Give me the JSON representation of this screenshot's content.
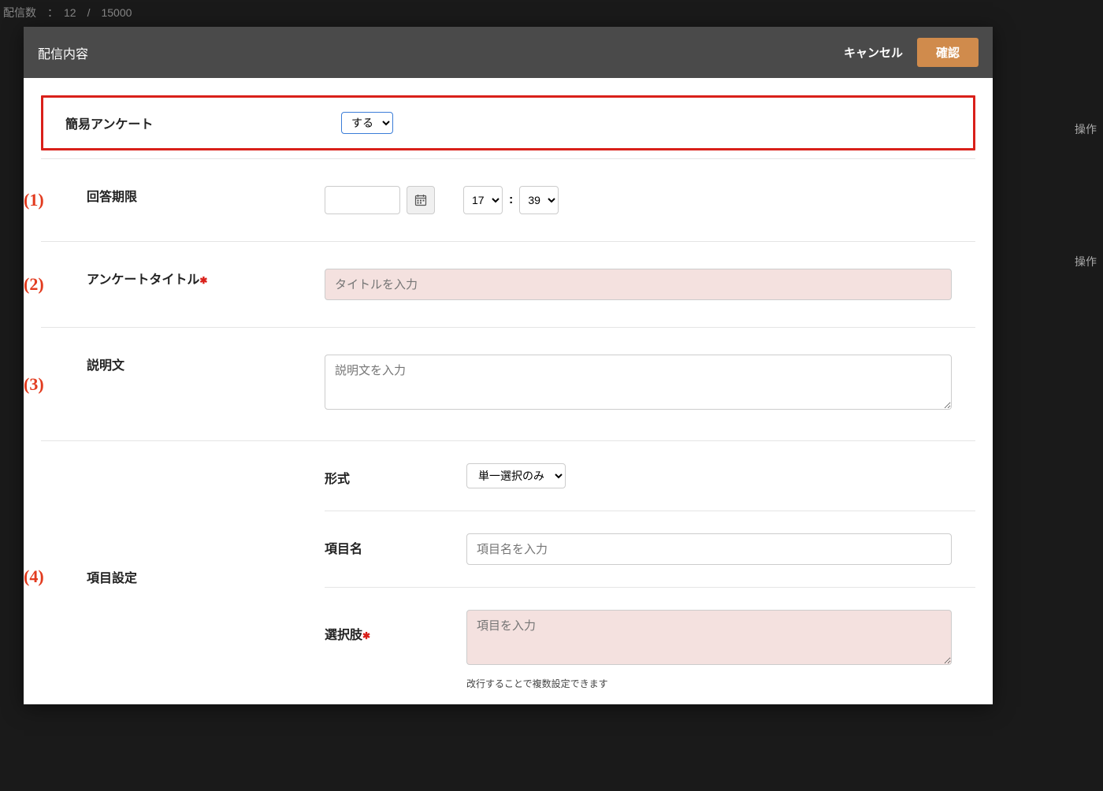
{
  "background": {
    "header_text": "配信数　：　12　/　15000",
    "right1": "操作",
    "right2": "操作"
  },
  "modal": {
    "title": "配信内容",
    "cancel": "キャンセル",
    "confirm": "確認"
  },
  "survey_toggle": {
    "label": "簡易アンケート",
    "value": "する"
  },
  "markers": {
    "m1": "(1)",
    "m2": "(2)",
    "m3": "(3)",
    "m4": "(4)"
  },
  "deadline": {
    "label": "回答期限",
    "date_value": "",
    "hour": "17",
    "minute": "39",
    "colon": ":"
  },
  "title_field": {
    "label": "アンケートタイトル",
    "placeholder": "タイトルを入力"
  },
  "desc_field": {
    "label": "説明文",
    "placeholder": "説明文を入力"
  },
  "items": {
    "label": "項目設定",
    "format_label": "形式",
    "format_value": "単一選択のみ",
    "name_label": "項目名",
    "name_placeholder": "項目名を入力",
    "choices_label": "選択肢",
    "choices_placeholder": "項目を入力",
    "choices_help": "改行することで複数設定できます"
  }
}
